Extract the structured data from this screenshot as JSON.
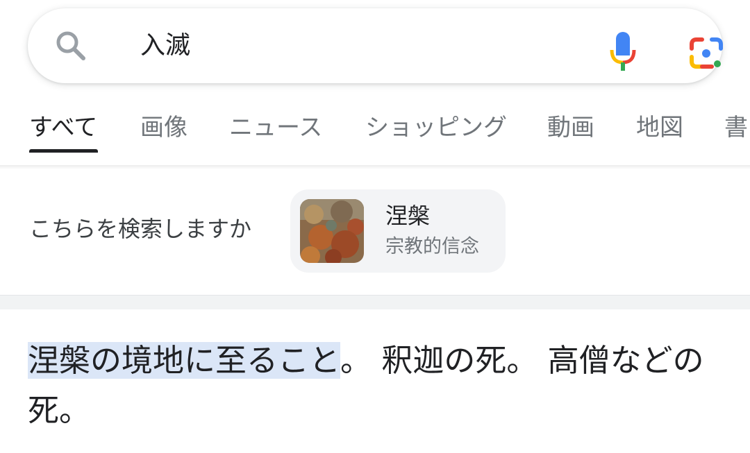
{
  "search": {
    "query": "入滅"
  },
  "tabs": [
    {
      "label": "すべて",
      "active": true
    },
    {
      "label": "画像"
    },
    {
      "label": "ニュース"
    },
    {
      "label": "ショッピング"
    },
    {
      "label": "動画"
    },
    {
      "label": "地図"
    },
    {
      "label": "書"
    }
  ],
  "did_you_mean": {
    "label": "こちらを検索しますか",
    "entity": {
      "title": "涅槃",
      "subtitle": "宗教的信念"
    }
  },
  "definition": {
    "highlighted": "涅槃の境地に至ること",
    "rest": "。 釈迦の死。 高僧などの死。"
  },
  "colors": {
    "highlight": "#dbe6f7",
    "active_tab": "#202124",
    "inactive_tab": "#70757a",
    "chip_bg": "#f3f4f6"
  }
}
